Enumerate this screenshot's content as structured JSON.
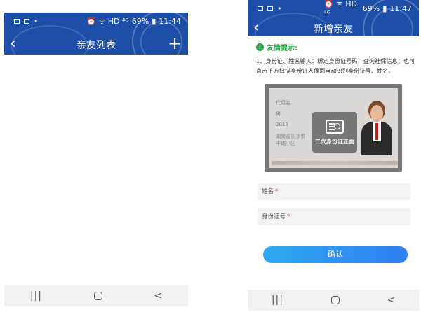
{
  "left": {
    "status": {
      "time": "11:44",
      "battery": "69%",
      "icons": "⏰ ᯤ HD ⁴ᴳ"
    },
    "title": "亲友列表",
    "back_icon": "back-icon",
    "add_icon": "plus-icon",
    "navbar": {
      "recent": "|||",
      "home": "home-button",
      "back": "<"
    }
  },
  "right": {
    "status": {
      "time": "11:47",
      "battery": "69%",
      "icons": "⏰ ᯤ HD ⁴ᴳ"
    },
    "title": "新增亲友",
    "tip_title": "友情提示:",
    "tip_text": "1、身份证、姓名输入：绑定身份证号码，查询社保信息；也可点击下方扫描身份证人像面自动识别身份证号、姓名。",
    "id_card_overlay": "二代身份证正面",
    "id_card_rows": [
      "代用名",
      "男",
      "2013",
      "湖南省长沙市",
      "丰瑞小区"
    ],
    "name_label": "姓名",
    "id_label": "身份证号",
    "required_mark": "*",
    "confirm": "确认",
    "navbar": {
      "recent": "|||",
      "home": "home-button",
      "back": "<"
    }
  },
  "colors": {
    "header": "#1e4fa8",
    "tip": "#27a844",
    "button": "#2f8ff0",
    "required": "#e33"
  }
}
